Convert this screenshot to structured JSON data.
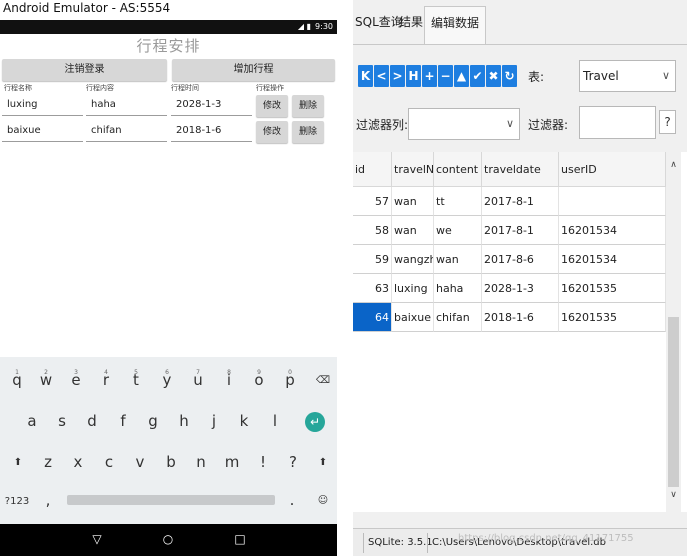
{
  "emulator": {
    "window_title": "Android Emulator - AS:5554",
    "status_time": "9:30",
    "status_icons": "◢ ▮",
    "app": {
      "title": "行程安排",
      "buttons": {
        "logout": "注销登录",
        "add_trip": "增加行程"
      },
      "headers": {
        "name": "行程名称",
        "content": "行程内容",
        "time": "行程时间",
        "ops": "行程操作"
      },
      "rows": [
        {
          "name": "luxing",
          "content": "haha",
          "date": "2028-1-3",
          "edit": "修改",
          "delete": "删除"
        },
        {
          "name": "baixue",
          "content": "chifan",
          "date": "2018-1-6",
          "edit": "修改",
          "delete": "删除"
        }
      ]
    },
    "keyboard": {
      "row1": [
        "q",
        "w",
        "e",
        "r",
        "t",
        "y",
        "u",
        "i",
        "o",
        "p"
      ],
      "row1_hints": [
        "1",
        "2",
        "3",
        "4",
        "5",
        "6",
        "7",
        "8",
        "9",
        "0"
      ],
      "row2": [
        "a",
        "s",
        "d",
        "f",
        "g",
        "h",
        "j",
        "k",
        "l"
      ],
      "row3": [
        "z",
        "x",
        "c",
        "v",
        "b",
        "n",
        "m",
        "!",
        "?"
      ],
      "backspace": "⌫",
      "enter": "↵",
      "shift_left": "⬆",
      "shift_right": "⬆",
      "symbols": "?123",
      "comma": ",",
      "period": ".",
      "emoji": "☺"
    },
    "navbar": {
      "back": "▽",
      "home": "○",
      "recents": "□"
    }
  },
  "tool": {
    "tabs": [
      "SQL查询",
      "结果",
      "编辑数据"
    ],
    "active_tab": "编辑数据",
    "nav_buttons": [
      "K",
      "<",
      ">",
      "H",
      "+",
      "−",
      "▲",
      "✔",
      "✖",
      "↻"
    ],
    "table_label": "表:",
    "table_value": "Travel",
    "filter_col_label": "过滤器列:",
    "filter_col_value": "",
    "filter_label": "过滤器:",
    "filter_value": "",
    "filter_icon": "?",
    "columns": [
      "id",
      "travelName",
      "content",
      "traveldate",
      "userID"
    ],
    "rows": [
      [
        "57",
        "wan",
        "tt",
        "2017-8-1",
        ""
      ],
      [
        "58",
        "wan",
        "we",
        "2017-8-1",
        "16201534"
      ],
      [
        "59",
        "wangzhe",
        "wan",
        "2017-8-6",
        "16201534"
      ],
      [
        "63",
        "luxing",
        "haha",
        "2028-1-3",
        "16201535"
      ],
      [
        "64",
        "baixue",
        "chifan",
        "2018-1-6",
        "16201535"
      ]
    ],
    "selected_row": 4,
    "status": {
      "version": "SQLite: 3.5.1",
      "path": "C:\\Users\\Lenovo\\Desktop\\travel.db"
    },
    "watermark": "https://blog.csdn.net/qq_41171755"
  },
  "colors": {
    "accent_blue": "#1e7ee0",
    "selected_cell": "#0a64c8",
    "enter_key": "#26a69a"
  }
}
